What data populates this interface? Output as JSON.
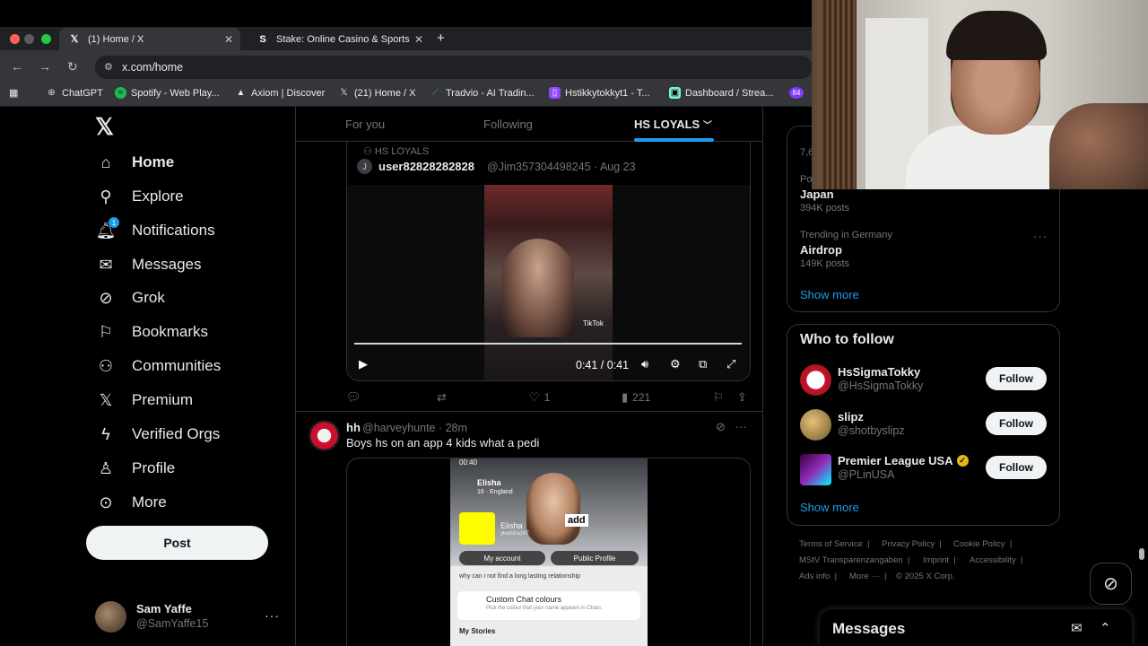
{
  "browser": {
    "tabs": [
      {
        "title": "(1) Home / X",
        "favicon": "x-logo",
        "active": true
      },
      {
        "title": "Stake: Online Casino & Sports",
        "favicon": "stake-logo",
        "active": false
      }
    ],
    "url": "x.com/home",
    "bookmarks": [
      {
        "label": "ChatGPT",
        "icon": "chatgpt-icon"
      },
      {
        "label": "Spotify - Web Play...",
        "icon": "spotify-icon"
      },
      {
        "label": "Axiom | Discover",
        "icon": "axiom-icon"
      },
      {
        "label": "(21) Home / X",
        "icon": "x-logo"
      },
      {
        "label": "Tradvio - AI Tradin...",
        "icon": "tradvio-icon"
      },
      {
        "label": "Hstikkytokkyt1 - T...",
        "icon": "twitch-icon"
      },
      {
        "label": "Dashboard / Strea...",
        "icon": "streamlabs-icon"
      },
      {
        "label": "84",
        "icon": "badge-icon"
      }
    ]
  },
  "sidebar": {
    "items": [
      {
        "label": "Home",
        "icon": "home-icon"
      },
      {
        "label": "Explore",
        "icon": "search-icon"
      },
      {
        "label": "Notifications",
        "icon": "bell-icon",
        "badge": "1"
      },
      {
        "label": "Messages",
        "icon": "envelope-icon"
      },
      {
        "label": "Grok",
        "icon": "grok-icon"
      },
      {
        "label": "Bookmarks",
        "icon": "bookmark-icon"
      },
      {
        "label": "Communities",
        "icon": "communities-icon"
      },
      {
        "label": "Premium",
        "icon": "x-logo"
      },
      {
        "label": "Verified Orgs",
        "icon": "lightning-icon"
      },
      {
        "label": "Profile",
        "icon": "person-icon"
      },
      {
        "label": "More",
        "icon": "more-circle-icon"
      }
    ],
    "post_label": "Post",
    "account": {
      "name": "Sam Yaffe",
      "handle": "@SamYaffe15"
    }
  },
  "feed": {
    "tabs": [
      "For you",
      "Following",
      "HS LOYALS"
    ],
    "post1": {
      "community": "HS LOYALS",
      "avatar_letter": "J",
      "author": "user82828282828",
      "handle": "@Jim357304498245 · Aug 23",
      "video_time": "0:41 / 0:41",
      "video_progress": 1.0,
      "watermark": "TikTok",
      "likes": "1",
      "views": "221"
    },
    "post2": {
      "author": "hh",
      "handle": "@harveyhunte · 28m",
      "text": "Boys hs on an app 4 kids what a pedi",
      "snap": {
        "status_time": "00:40",
        "name": "Elisha",
        "sub": "16 · England",
        "display": "Elisha",
        "username": "ykelisha167",
        "add_label": "add",
        "my_account": "My account",
        "public_profile": "Public Profile",
        "list_line": "why can i not find a long lasting relationship",
        "card_title": "Custom Chat colours",
        "card_sub": "Pick the colour that your name appears in Chats.",
        "stories": "My Stories"
      }
    }
  },
  "right": {
    "trends": [
      {
        "context": "7,6",
        "topic": "",
        "posts": ""
      },
      {
        "context": "Po",
        "topic": "Japan",
        "posts": "394K posts"
      },
      {
        "context": "Trending in Germany",
        "topic": "Airdrop",
        "posts": "149K posts"
      }
    ],
    "show_more": "Show more",
    "who_to_follow": {
      "title": "Who to follow",
      "users": [
        {
          "name": "HsSigmaTokky",
          "handle": "@HsSigmaTokky",
          "verified": false
        },
        {
          "name": "slipz",
          "handle": "@shotbyslipz",
          "verified": false
        },
        {
          "name": "Premier League USA",
          "handle": "@PLinUSA",
          "verified": true
        }
      ],
      "follow_label": "Follow",
      "show_more": "Show more"
    },
    "footer": [
      "Terms of Service",
      "Privacy Policy",
      "Cookie Policy",
      "MStV Transparenzangaben",
      "Imprint",
      "Accessibility",
      "Ads info",
      "More ···",
      "© 2025 X Corp."
    ],
    "messages_title": "Messages"
  },
  "colors": {
    "accent": "#1d9bf0",
    "background": "#000000",
    "muted": "#71767b"
  }
}
